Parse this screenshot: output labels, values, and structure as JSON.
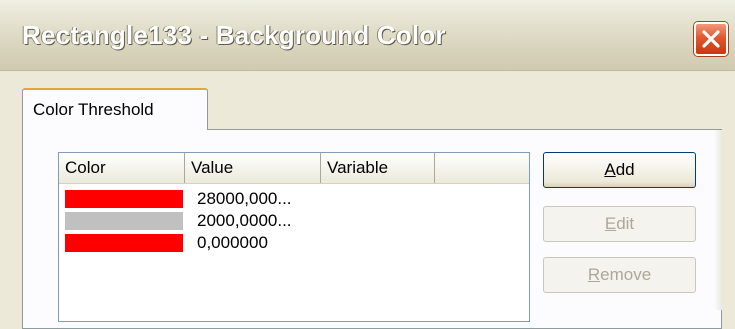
{
  "window": {
    "title": "Rectangle133 - Background Color"
  },
  "tabs": [
    {
      "label": "Color Threshold",
      "active": true
    }
  ],
  "list": {
    "columns": [
      "Color",
      "Value",
      "Variable",
      ""
    ],
    "rows": [
      {
        "color": "#ff0000",
        "value": "28000,000..."
      },
      {
        "color": "#c0c0c0",
        "value": "2000,0000..."
      },
      {
        "color": "#ff0000",
        "value": "0,000000"
      }
    ]
  },
  "buttons": {
    "add": {
      "mnemonic": "A",
      "rest": "dd",
      "enabled": true
    },
    "edit": {
      "mnemonic": "E",
      "rest": "dit",
      "enabled": false
    },
    "remove": {
      "mnemonic": "R",
      "rest": "emove",
      "enabled": false
    }
  },
  "colors": {
    "close_button": "#e4572e",
    "tab_highlight": "#e6a43c"
  }
}
